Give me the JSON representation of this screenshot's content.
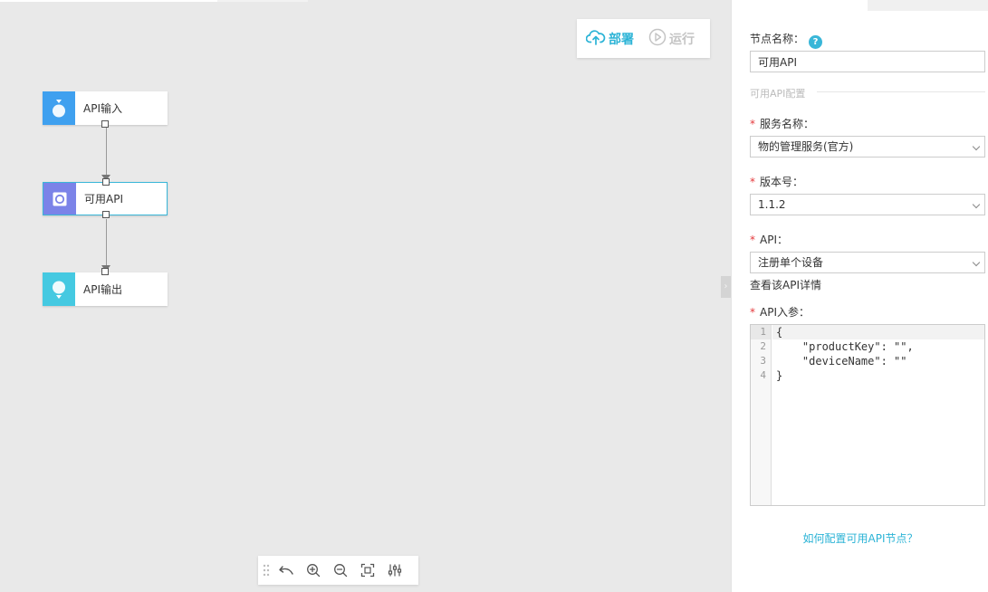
{
  "actions": {
    "deploy_label": "部署",
    "run_label": "运行",
    "deploy_color": "#2bb3d6",
    "run_color": "#c4c4c4"
  },
  "nodes": [
    {
      "label": "API输入",
      "icon": "api-input-icon",
      "color": "#3fa0ef"
    },
    {
      "label": "可用API",
      "icon": "available-api-icon",
      "color": "#7b83e8",
      "selected": true
    },
    {
      "label": "API输出",
      "icon": "api-output-icon",
      "color": "#45c9e1"
    }
  ],
  "toolbar": {
    "tools": [
      "drag-handle-icon",
      "undo-icon",
      "zoom-in-icon",
      "zoom-out-icon",
      "fit-screen-icon",
      "settings-icon"
    ]
  },
  "panel": {
    "node_name_label": "节点名称：",
    "help_glyph": "?",
    "node_name_value": "可用API",
    "section_title": "可用API配置",
    "service_label": "服务名称：",
    "service_value": "物的管理服务(官方)",
    "version_label": "版本号：",
    "version_value": "1.1.2",
    "api_label": "API：",
    "api_value": "注册单个设备",
    "view_detail": "查看该API详情",
    "params_label": "API入参：",
    "required_mark": "*",
    "code_lines": [
      {
        "n": "1",
        "text": "{"
      },
      {
        "n": "2",
        "text": "    \"productKey\": \"\","
      },
      {
        "n": "3",
        "text": "    \"deviceName\": \"\""
      },
      {
        "n": "4",
        "text": "}"
      }
    ],
    "help_link": "如何配置可用API节点？"
  }
}
